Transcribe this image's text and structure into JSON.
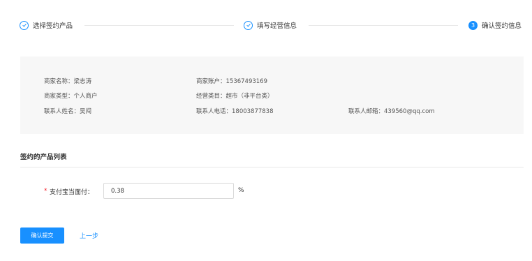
{
  "steps": [
    {
      "label": "选择签约产品",
      "status": "done",
      "icon": "check-icon"
    },
    {
      "label": "填写经营信息",
      "status": "done",
      "icon": "check-icon"
    },
    {
      "label": "确认签约信息",
      "status": "active",
      "number": "3"
    }
  ],
  "merchant": {
    "name_label": "商家名称：",
    "name_value": "梁志涛",
    "account_label": "商家账户：",
    "account_value": "15367493169",
    "type_label": "商家类型：",
    "type_value": "个人商户",
    "category_label": "经营类目：",
    "category_value": "超市（非平台类）",
    "contact_name_label": "联系人姓名：",
    "contact_name_value": "吴闯",
    "contact_phone_label": "联系人电话：",
    "contact_phone_value": "18003877838",
    "contact_email_label": "联系人邮箱：",
    "contact_email_value": "439560@qq.com"
  },
  "products": {
    "section_title": "签约的产品列表",
    "required_mark": "*",
    "rate_label": "支付宝当面付：",
    "rate_value": "0.38",
    "rate_unit": "%"
  },
  "actions": {
    "confirm_label": "确认提交",
    "back_label": "上一步"
  },
  "colors": {
    "primary": "#1890ff",
    "required": "#f5222d",
    "panel_bg": "#f7f7f7"
  }
}
